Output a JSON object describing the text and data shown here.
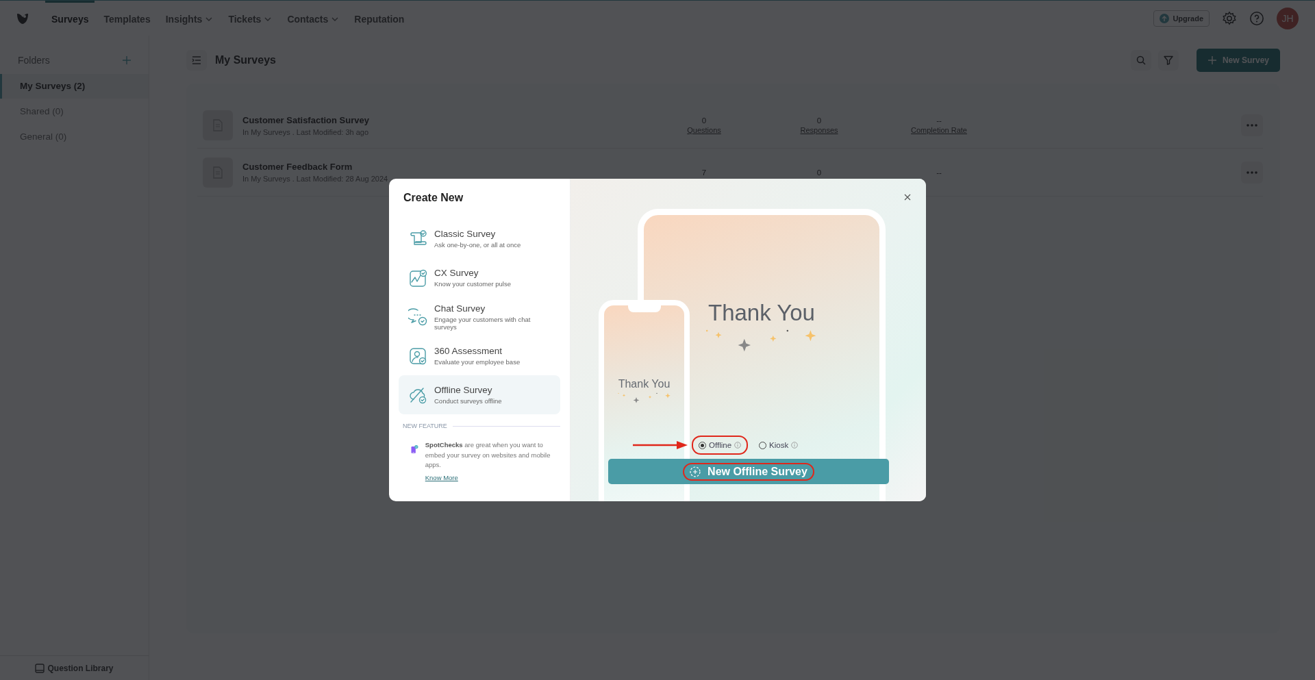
{
  "nav": {
    "items": [
      {
        "label": "Surveys",
        "selected": true,
        "dropdown": false
      },
      {
        "label": "Templates",
        "selected": false,
        "dropdown": false
      },
      {
        "label": "Insights",
        "selected": false,
        "dropdown": true
      },
      {
        "label": "Tickets",
        "selected": false,
        "dropdown": true
      },
      {
        "label": "Contacts",
        "selected": false,
        "dropdown": true
      },
      {
        "label": "Reputation",
        "selected": false,
        "dropdown": false
      }
    ],
    "upgrade": "Upgrade",
    "avatar": "JH"
  },
  "sidebar": {
    "heading": "Folders",
    "folders": [
      {
        "label": "My Surveys (2)",
        "selected": true
      },
      {
        "label": "Shared (0)",
        "selected": false
      },
      {
        "label": "General (0)",
        "selected": false
      }
    ],
    "footer": "Question Library"
  },
  "main": {
    "title": "My Surveys",
    "new_button": "New Survey",
    "surveys": [
      {
        "name": "Customer Satisfaction Survey",
        "meta": "In My Surveys . Last Modified: 3h ago",
        "stats": [
          {
            "value": "0",
            "label": "Questions"
          },
          {
            "value": "0",
            "label": "Responses"
          },
          {
            "value": "--",
            "label": "Completion Rate"
          }
        ]
      },
      {
        "name": "Customer Feedback Form",
        "meta": "In My Surveys . Last Modified: 28 Aug 2024",
        "stats": [
          {
            "value": "7"
          },
          {
            "value": "0"
          },
          {
            "value": "--"
          }
        ]
      }
    ]
  },
  "modal": {
    "title": "Create New",
    "types": [
      {
        "kind": "classic",
        "title": "Classic Survey",
        "description": "Ask one-by-one, or all at once",
        "selected": false
      },
      {
        "kind": "cx",
        "title": "CX Survey",
        "description": "Know your customer pulse",
        "selected": false
      },
      {
        "kind": "chat",
        "title": "Chat Survey",
        "description": "Engage your customers with chat surveys",
        "selected": false
      },
      {
        "kind": "assessment",
        "title": "360 Assessment",
        "description": "Evaluate your employee base",
        "selected": false
      },
      {
        "kind": "offline",
        "title": "Offline Survey",
        "description": "Conduct surveys offline",
        "selected": true
      }
    ],
    "feature_label": "NEW FEATURE",
    "feature_text": "**SpotChecks** are great when you want to embed your survey on websites and mobile apps.",
    "feature_link": "Know More",
    "preview": {
      "tablet_text": "Thank You",
      "phone_text": "Thank You"
    },
    "modes": [
      {
        "label": "Offline",
        "selected": true,
        "highlighted": true
      },
      {
        "label": "Kiosk",
        "selected": false,
        "highlighted": false
      }
    ],
    "create_button": {
      "label": "New Offline Survey",
      "highlighted": true
    }
  }
}
